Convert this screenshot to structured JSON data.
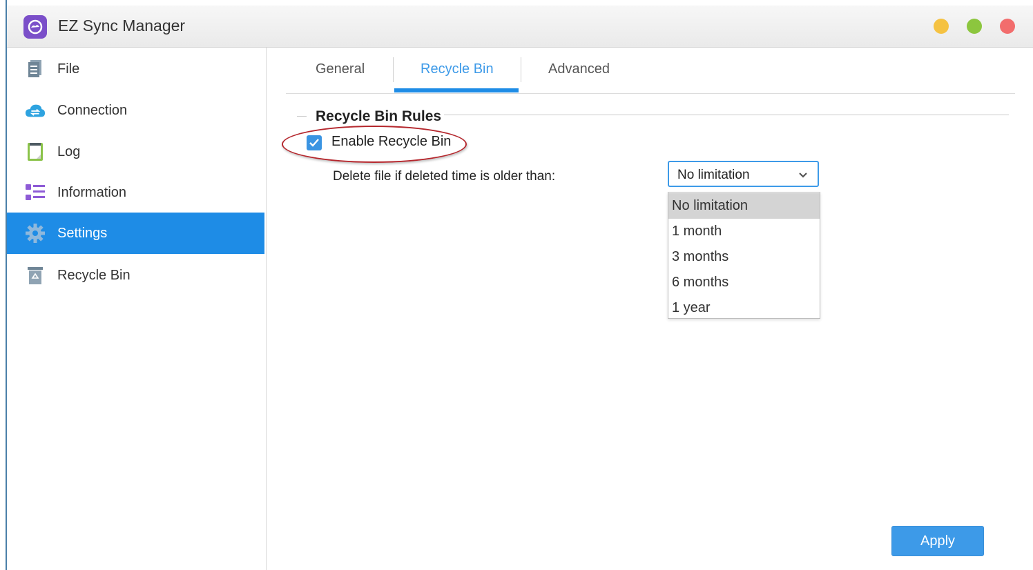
{
  "app": {
    "title": "EZ Sync Manager",
    "window_controls": [
      {
        "name": "minimize",
        "color": "#f5c242"
      },
      {
        "name": "maximize",
        "color": "#8cc63e"
      },
      {
        "name": "close",
        "color": "#f26d6d"
      }
    ]
  },
  "sidebar": {
    "items": [
      {
        "label": "File",
        "icon": "file-icon"
      },
      {
        "label": "Connection",
        "icon": "cloud-sync-icon"
      },
      {
        "label": "Log",
        "icon": "log-icon"
      },
      {
        "label": "Information",
        "icon": "list-icon"
      },
      {
        "label": "Settings",
        "icon": "gear-icon",
        "active": true
      },
      {
        "label": "Recycle Bin",
        "icon": "recycle-bin-icon"
      }
    ]
  },
  "tabs": [
    {
      "label": "General"
    },
    {
      "label": "Recycle Bin",
      "active": true
    },
    {
      "label": "Advanced"
    }
  ],
  "recycle": {
    "section_title": "Recycle Bin Rules",
    "enable_label": "Enable Recycle Bin",
    "enable_checked": true,
    "delete_label": "Delete file if deleted time is older than:",
    "selected_value": "No limitation",
    "options": [
      "No limitation",
      "1 month",
      "3 months",
      "6 months",
      "1 year"
    ]
  },
  "actions": {
    "apply_label": "Apply"
  },
  "colors": {
    "accent": "#1e8ce6",
    "highlight_circle": "#b5272d"
  }
}
